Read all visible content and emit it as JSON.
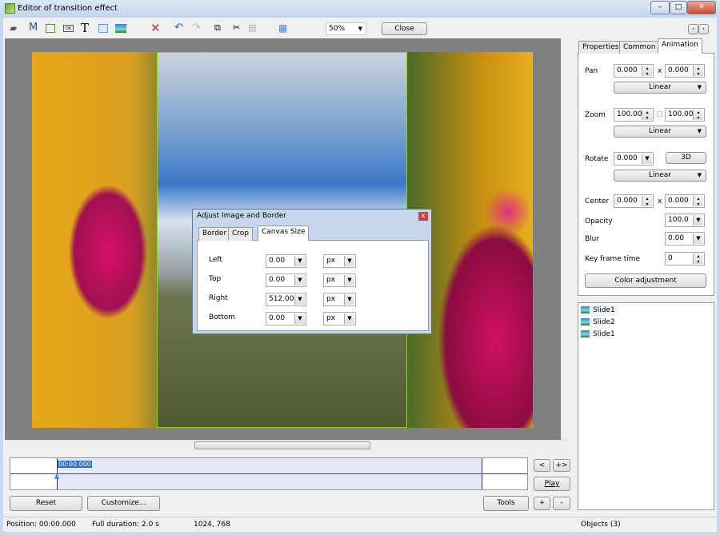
{
  "window": {
    "title": "Editor of transition effect",
    "min": "–",
    "max": "□",
    "close": "✕"
  },
  "toolbar": {
    "icons": [
      "camera-icon",
      "mask-icon",
      "frame-icon",
      "button-icon",
      "text-icon",
      "rectangle-icon",
      "image-icon",
      "delete-icon",
      "undo-icon",
      "redo-icon",
      "copy-icon",
      "cut-icon",
      "paste-icon",
      "grid-icon"
    ],
    "M": "M",
    "ok": "OK",
    "T": "T",
    "zoom": "50%",
    "close": "Close"
  },
  "dialog": {
    "title": "Adjust Image and Border",
    "close": "x",
    "tabs": [
      "Border",
      "Crop",
      "Canvas Size"
    ],
    "rows": [
      {
        "label": "Left",
        "value": "0.00",
        "unit": "px"
      },
      {
        "label": "Top",
        "value": "0.00",
        "unit": "px"
      },
      {
        "label": "Right",
        "value": "512.00",
        "unit": "px"
      },
      {
        "label": "Bottom",
        "value": "0.00",
        "unit": "px"
      }
    ]
  },
  "timeline": {
    "time": "00:00.000",
    "prev": "<",
    "next": "+>",
    "play": "Play",
    "reset": "Reset",
    "customize": "Customize...",
    "tools": "Tools",
    "plus": "+",
    "minus": "-"
  },
  "panel": {
    "tabs": [
      "Properties",
      "Common",
      "Animation"
    ],
    "pan_label": "Pan",
    "pan_x": "0.000",
    "pan_y": "0.000",
    "x": "x",
    "linear": "Linear",
    "zoom_label": "Zoom",
    "zoom_x": "100.000",
    "zoom_y": "100.000",
    "rotate_label": "Rotate",
    "rotate": "0.000",
    "btn3d": "3D",
    "center_label": "Center",
    "center_x": "0.000",
    "center_y": "0.000",
    "opacity_label": "Opacity",
    "opacity": "100.0",
    "blur_label": "Blur",
    "blur": "0.00",
    "keyframe_label": "Key frame time",
    "keyframe": "0",
    "color_adj": "Color adjustment"
  },
  "objects": [
    "Slide1",
    "Slide2",
    "Slide1"
  ],
  "status": {
    "position": "Position:  00:00.000",
    "duration": "Full duration:  2.0 s",
    "size": "1024, 768",
    "objects": "Objects (3)"
  }
}
